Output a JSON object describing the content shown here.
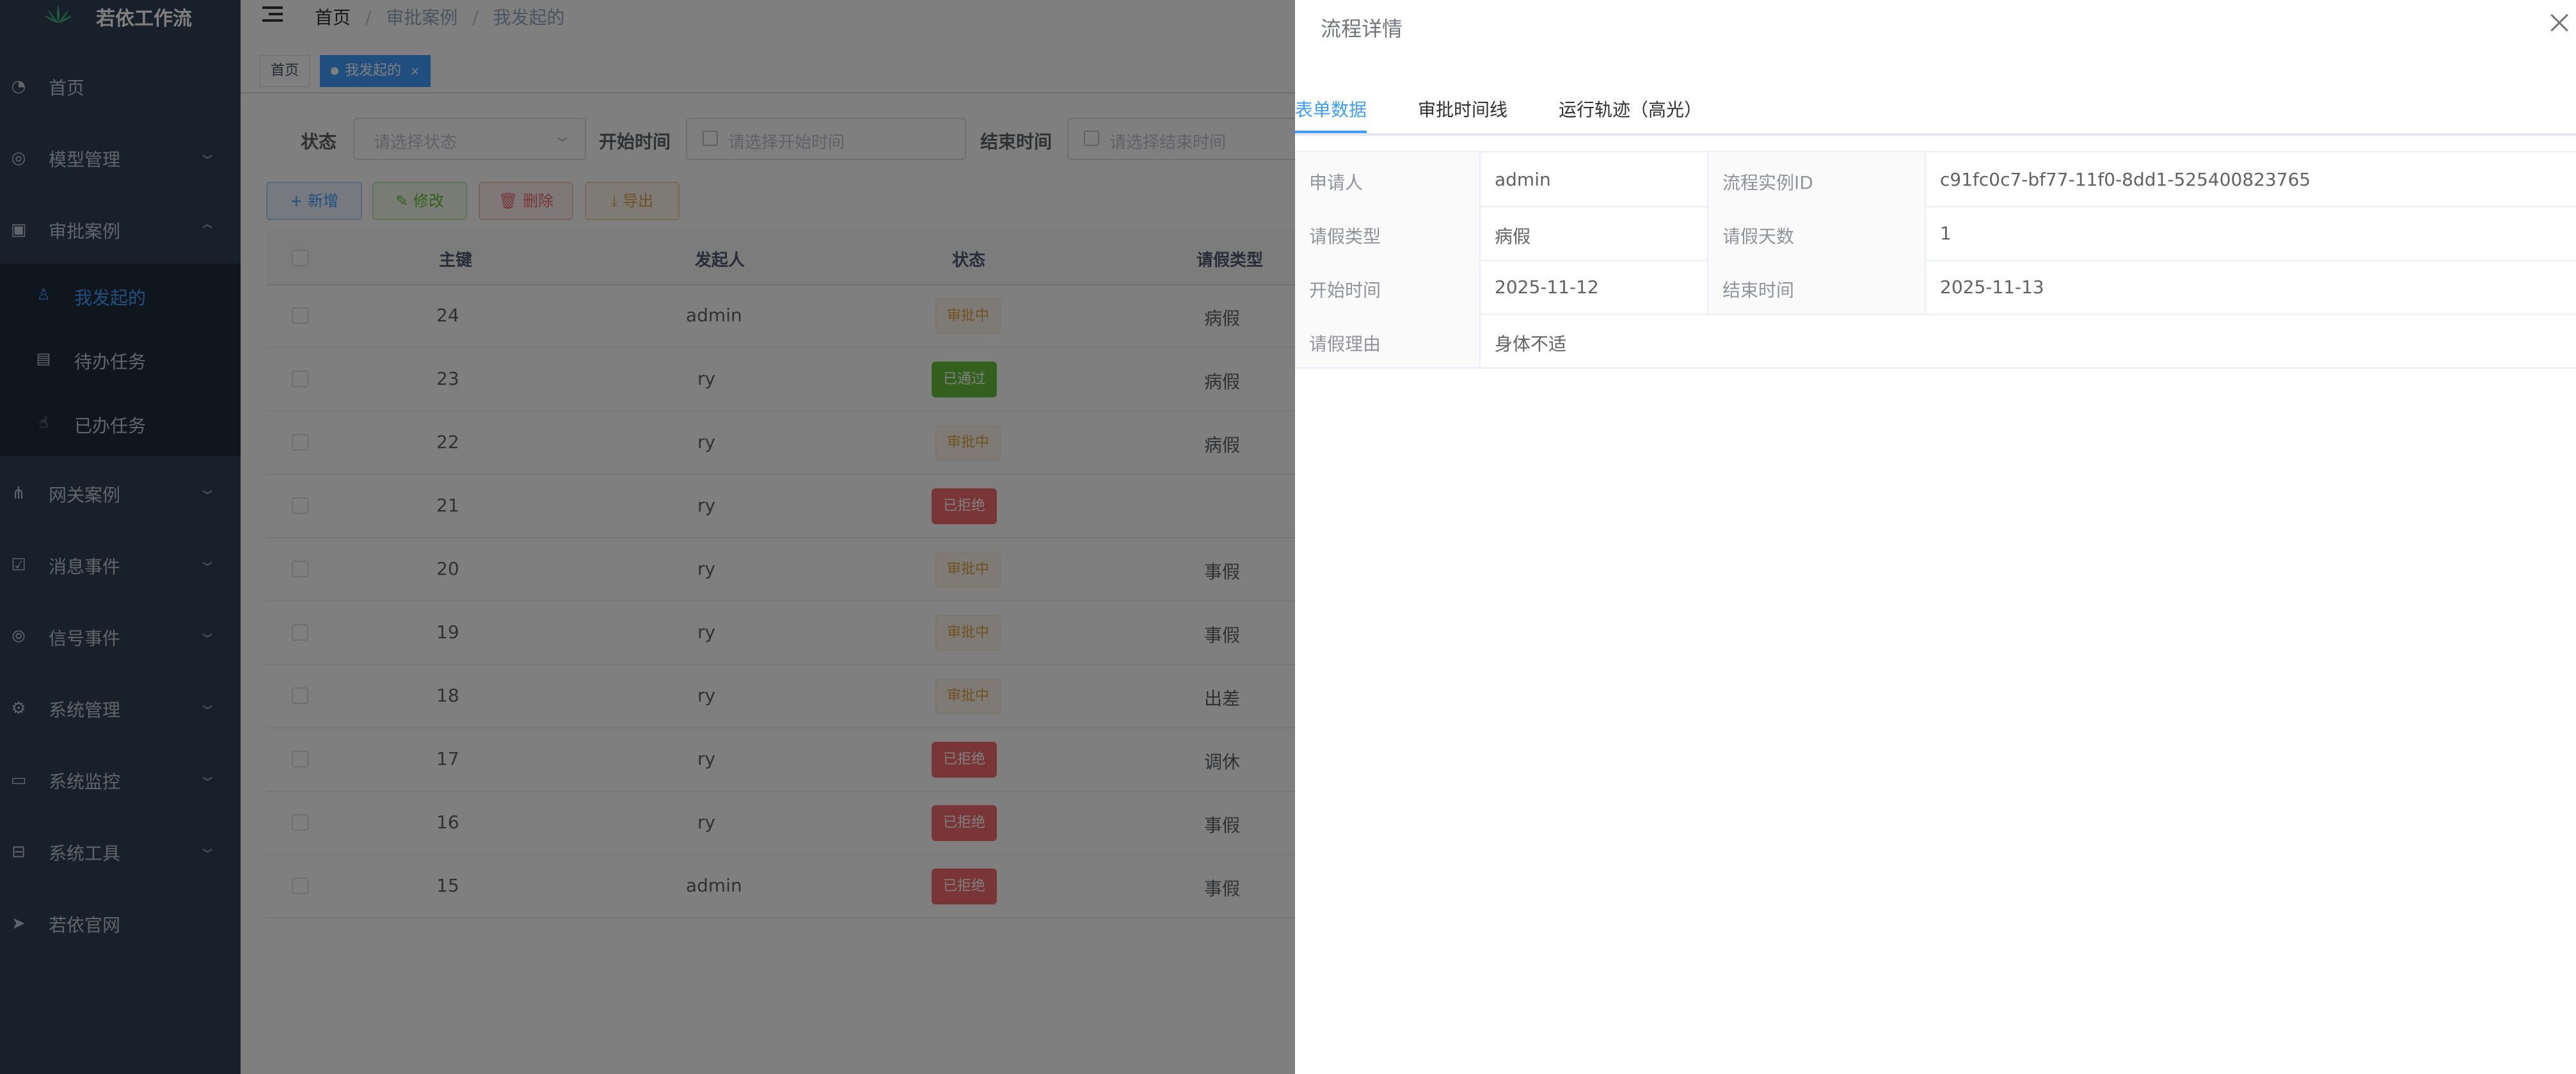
{
  "app": {
    "title": "若依工作流"
  },
  "sidebar": {
    "items": [
      {
        "label": "首页",
        "icon": "dashboard-icon"
      },
      {
        "label": "模型管理",
        "icon": "model-icon"
      },
      {
        "label": "审批案例",
        "icon": "approval-icon",
        "expanded": true
      },
      {
        "label": "网关案例",
        "icon": "tree-icon"
      },
      {
        "label": "消息事件",
        "icon": "checkbox-icon"
      },
      {
        "label": "信号事件",
        "icon": "signal-icon"
      },
      {
        "label": "系统管理",
        "icon": "gear-icon"
      },
      {
        "label": "系统监控",
        "icon": "monitor-icon"
      },
      {
        "label": "系统工具",
        "icon": "toolbox-icon"
      },
      {
        "label": "若依官网",
        "icon": "send-icon"
      }
    ],
    "submenu": [
      {
        "label": "我发起的",
        "active": true
      },
      {
        "label": "待办任务"
      },
      {
        "label": "已办任务"
      }
    ]
  },
  "breadcrumb": [
    "首页",
    "审批案例",
    "我发起的"
  ],
  "breadcrumb_sep": "/",
  "tags": [
    {
      "label": "首页"
    },
    {
      "label": "我发起的",
      "active": true,
      "close": "×"
    }
  ],
  "filters": {
    "status_label": "状态",
    "status_placeholder": "请选择状态",
    "start_label": "开始时间",
    "start_placeholder": "请选择开始时间",
    "end_label": "结束时间",
    "end_placeholder": "请选择结束时间"
  },
  "toolbar": {
    "add": "+ 新增",
    "edit": "修改",
    "delete": "删除",
    "export": "导出"
  },
  "table": {
    "headers": [
      "主键",
      "发起人",
      "状态",
      "请假类型"
    ],
    "rows": [
      {
        "id": "24",
        "initiator": "admin",
        "status": "审批中",
        "status_kind": "pending",
        "type": "病假"
      },
      {
        "id": "23",
        "initiator": "ry",
        "status": "已通过",
        "status_kind": "passed",
        "type": "病假"
      },
      {
        "id": "22",
        "initiator": "ry",
        "status": "审批中",
        "status_kind": "pending",
        "type": "病假"
      },
      {
        "id": "21",
        "initiator": "ry",
        "status": "已拒绝",
        "status_kind": "rejected",
        "type": ""
      },
      {
        "id": "20",
        "initiator": "ry",
        "status": "审批中",
        "status_kind": "pending",
        "type": "事假"
      },
      {
        "id": "19",
        "initiator": "ry",
        "status": "审批中",
        "status_kind": "pending",
        "type": "事假"
      },
      {
        "id": "18",
        "initiator": "ry",
        "status": "审批中",
        "status_kind": "pending",
        "type": "出差"
      },
      {
        "id": "17",
        "initiator": "ry",
        "status": "已拒绝",
        "status_kind": "rejected",
        "type": "调休"
      },
      {
        "id": "16",
        "initiator": "ry",
        "status": "已拒绝",
        "status_kind": "rejected",
        "type": "事假"
      },
      {
        "id": "15",
        "initiator": "admin",
        "status": "已拒绝",
        "status_kind": "rejected",
        "type": "事假"
      }
    ]
  },
  "drawer": {
    "title": "流程详情",
    "tabs": [
      "表单数据",
      "审批时间线",
      "运行轨迹（高光）"
    ],
    "active_tab": 0,
    "fields": {
      "applicant_label": "申请人",
      "applicant": "admin",
      "instance_label": "流程实例ID",
      "instance": "c91fc0c7-bf77-11f0-8dd1-525400823765",
      "leave_type_label": "请假类型",
      "leave_type": "病假",
      "leave_days_label": "请假天数",
      "leave_days": "1",
      "start_label": "开始时间",
      "start": "2025-11-12",
      "end_label": "结束时间",
      "end": "2025-11-13",
      "reason_label": "请假理由",
      "reason": "身体不适"
    }
  },
  "colors": {
    "sidebar_bg": "#304156",
    "primary": "#409eff",
    "success": "#67c23a",
    "danger": "#f56c6c",
    "warning": "#e6a23c"
  }
}
